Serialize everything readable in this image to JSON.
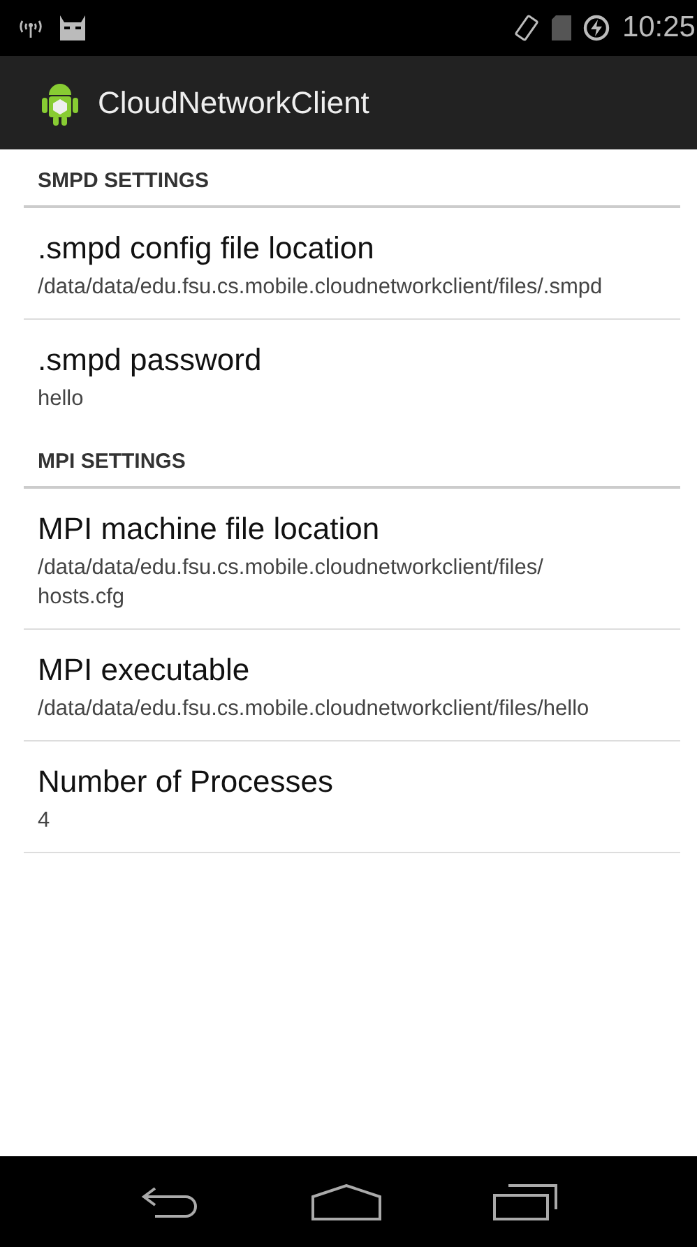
{
  "status_bar": {
    "time": "10:25"
  },
  "action_bar": {
    "title": "CloudNetworkClient"
  },
  "sections": [
    {
      "title": "SMPD SETTINGS",
      "items": [
        {
          "title": ".smpd config file location",
          "summary": "/data/data/edu.fsu.cs.mobile.cloudnetworkclient/files/.smpd"
        },
        {
          "title": ".smpd password",
          "summary": "hello"
        }
      ]
    },
    {
      "title": "MPI SETTINGS",
      "items": [
        {
          "title": "MPI machine file location",
          "summary": "/data/data/edu.fsu.cs.mobile.cloudnetworkclient/files/hosts.cfg"
        },
        {
          "title": "MPI executable",
          "summary": "/data/data/edu.fsu.cs.mobile.cloudnetworkclient/files/hello"
        },
        {
          "title": "Number of Processes",
          "summary": "4"
        }
      ]
    }
  ]
}
